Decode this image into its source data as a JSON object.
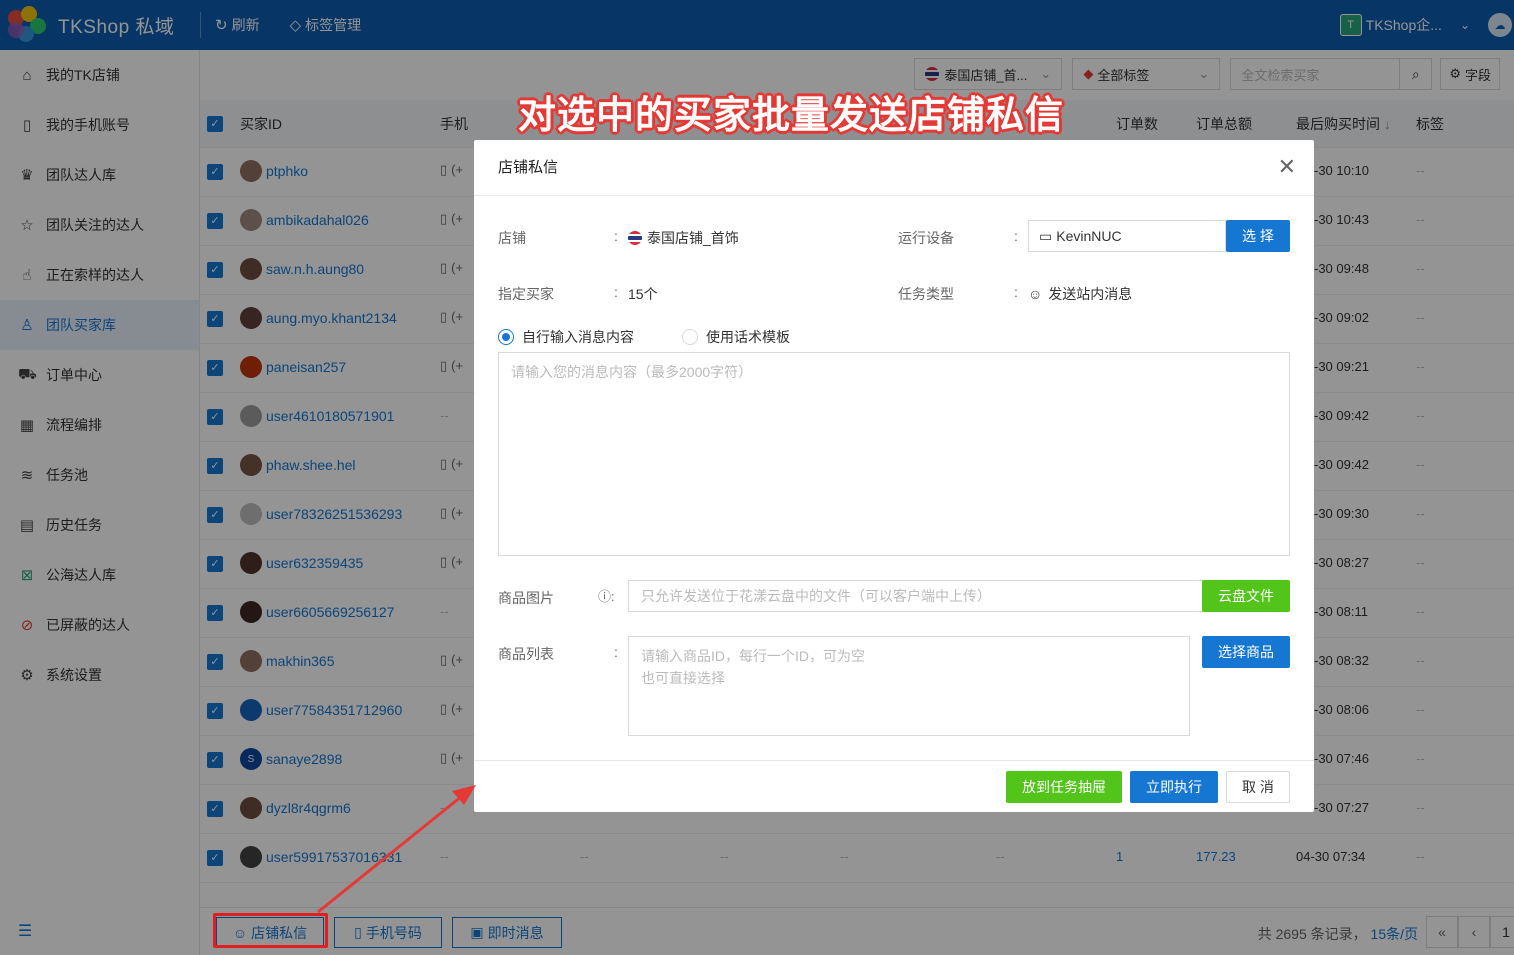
{
  "app": {
    "name": "TKShop 私域"
  },
  "toolbar": {
    "refresh_label": "刷新",
    "tags_label": "标签管理"
  },
  "account": {
    "avatar_letter": "T",
    "name": "TKShop企..."
  },
  "sidebar": {
    "items": [
      {
        "label": "我的TK店铺",
        "icon": "store-icon"
      },
      {
        "label": "我的手机账号",
        "icon": "phone-icon"
      },
      {
        "label": "团队达人库",
        "icon": "crown-icon"
      },
      {
        "label": "团队关注的达人",
        "icon": "star-icon"
      },
      {
        "label": "正在索样的达人",
        "icon": "hand-icon"
      },
      {
        "label": "团队买家库",
        "icon": "user-icon",
        "active": true
      },
      {
        "label": "订单中心",
        "icon": "truck-icon"
      },
      {
        "label": "流程编排",
        "icon": "calendar-icon"
      },
      {
        "label": "任务池",
        "icon": "layers-icon"
      },
      {
        "label": "历史任务",
        "icon": "clipboard-icon"
      },
      {
        "label": "公海达人库",
        "icon": "public-icon"
      },
      {
        "label": "已屏蔽的达人",
        "icon": "block-icon"
      },
      {
        "label": "系统设置",
        "icon": "gear-icon"
      }
    ]
  },
  "filters": {
    "shop": "泰国店铺_首...",
    "tags": "全部标签",
    "search_placeholder": "全文检索买家",
    "fields_label": "字段"
  },
  "table": {
    "headers": {
      "buyer_id": "买家ID",
      "phone": "手机",
      "orders": "订单数",
      "total": "订单总额",
      "last_buy": "最后购买时间",
      "tags": "标签"
    },
    "rows": [
      {
        "buyer": "ptphko",
        "phone_icon": true,
        "time": "-30 10:10",
        "tag": "--"
      },
      {
        "buyer": "ambikadahal026",
        "phone_icon": true,
        "time": "-30 10:43",
        "tag": "--"
      },
      {
        "buyer": "saw.n.h.aung80",
        "phone_icon": true,
        "time": "-30 09:48",
        "tag": "--"
      },
      {
        "buyer": "aung.myo.khant2134",
        "phone_icon": true,
        "time": "-30 09:02",
        "tag": "--"
      },
      {
        "buyer": "paneisan257",
        "phone_icon": true,
        "time": "-30 09:21",
        "tag": "--"
      },
      {
        "buyer": "user4610180571901",
        "phone_icon": false,
        "time": "-30 09:42",
        "tag": "--"
      },
      {
        "buyer": "phaw.shee.hel",
        "phone_icon": true,
        "time": "-30 09:42",
        "tag": "--"
      },
      {
        "buyer": "user78326251536293",
        "phone_icon": true,
        "time": "-30 09:30",
        "tag": "--"
      },
      {
        "buyer": "user632359435",
        "phone_icon": true,
        "time": "-30 08:27",
        "tag": "--"
      },
      {
        "buyer": "user6605669256127",
        "phone_icon": false,
        "time": "-30 08:11",
        "tag": "--"
      },
      {
        "buyer": "makhin365",
        "phone_icon": true,
        "time": "-30 08:32",
        "tag": "--"
      },
      {
        "buyer": "user77584351712960",
        "phone_icon": true,
        "time": "-30 08:06",
        "tag": "--"
      },
      {
        "buyer": "sanaye2898",
        "phone_icon": true,
        "time": "-30 07:46",
        "tag": "--"
      },
      {
        "buyer": "dyzl8r4qgrm6",
        "phone_icon": false,
        "time": "-30 07:27",
        "tag": "--"
      },
      {
        "buyer": "user59917537016331",
        "phone_icon": false,
        "orders": "1",
        "total": "177.23",
        "time": "04-30 07:34",
        "tag": "--"
      }
    ]
  },
  "phone_prefix": "(+",
  "dash": "--",
  "annotation": "对选中的买家批量发送店铺私信",
  "dialog": {
    "title": "店铺私信",
    "shop_label": "店铺",
    "shop_value": "泰国店铺_首饰",
    "device_label": "运行设备",
    "device_value": "KevinNUC",
    "select_btn": "选 择",
    "buyers_label": "指定买家",
    "buyers_value": "15个",
    "task_type_label": "任务类型",
    "task_type_value": "发送站内消息",
    "radio_custom": "自行输入消息内容",
    "radio_template": "使用话术模板",
    "message_placeholder": "请输入您的消息内容（最多2000字符）",
    "image_label": "商品图片",
    "image_placeholder": "只允许发送位于花漾云盘中的文件（可以客户端中上传）",
    "cloud_btn": "云盘文件",
    "list_label": "商品列表",
    "list_placeholder_1": "请输入商品ID，每行一个ID，可为空",
    "list_placeholder_2": "也可直接选择",
    "select_goods_btn": "选择商品",
    "drawer_btn": "放到任务抽屉",
    "run_btn": "立即执行",
    "cancel_btn": "取 消"
  },
  "bottom": {
    "shop_msg_btn": "店铺私信",
    "phone_btn": "手机号码",
    "im_btn": "即时消息",
    "total_text": "共 2695 条记录，",
    "page_size": "15条/页",
    "page_first": "«",
    "page_prev": "‹",
    "page_num": "1"
  },
  "colors": {
    "brand": "#0d5db0",
    "primary": "#1677d2",
    "success": "#52c41a",
    "annotation": "#e53935"
  }
}
